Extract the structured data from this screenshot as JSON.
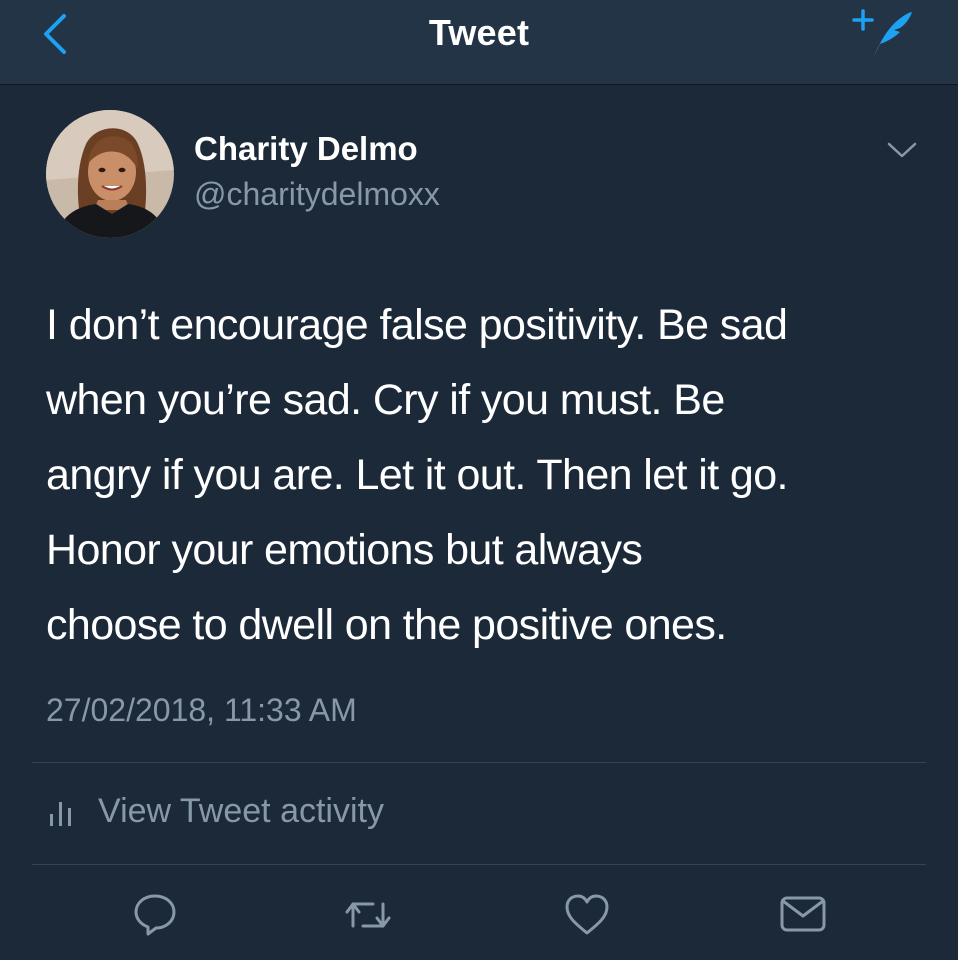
{
  "header": {
    "title": "Tweet",
    "back_icon": "chevron-left-icon",
    "compose_icon": "compose-tweet-icon"
  },
  "tweet": {
    "author_name": "Charity Delmo",
    "author_handle": "@charitydelmoxx",
    "text": "I don’t encourage false positivity. Be sad\nwhen you’re sad. Cry if you must. Be\nangry if you are. Let it out. Then let it go.\nHonor your emotions but always\nchoose to dwell on the positive ones.",
    "timestamp": "27/02/2018, 11:33 AM"
  },
  "activity": {
    "label": "View Tweet activity",
    "icon": "bar-chart-icon"
  },
  "actions": [
    {
      "icon": "reply-icon"
    },
    {
      "icon": "retweet-icon"
    },
    {
      "icon": "like-icon"
    },
    {
      "icon": "direct-message-icon"
    }
  ],
  "colors": {
    "background": "#1c2938",
    "navbar": "#243447",
    "accent": "#1da1f2",
    "secondary_text": "#8899a6",
    "divider": "#38444d"
  }
}
